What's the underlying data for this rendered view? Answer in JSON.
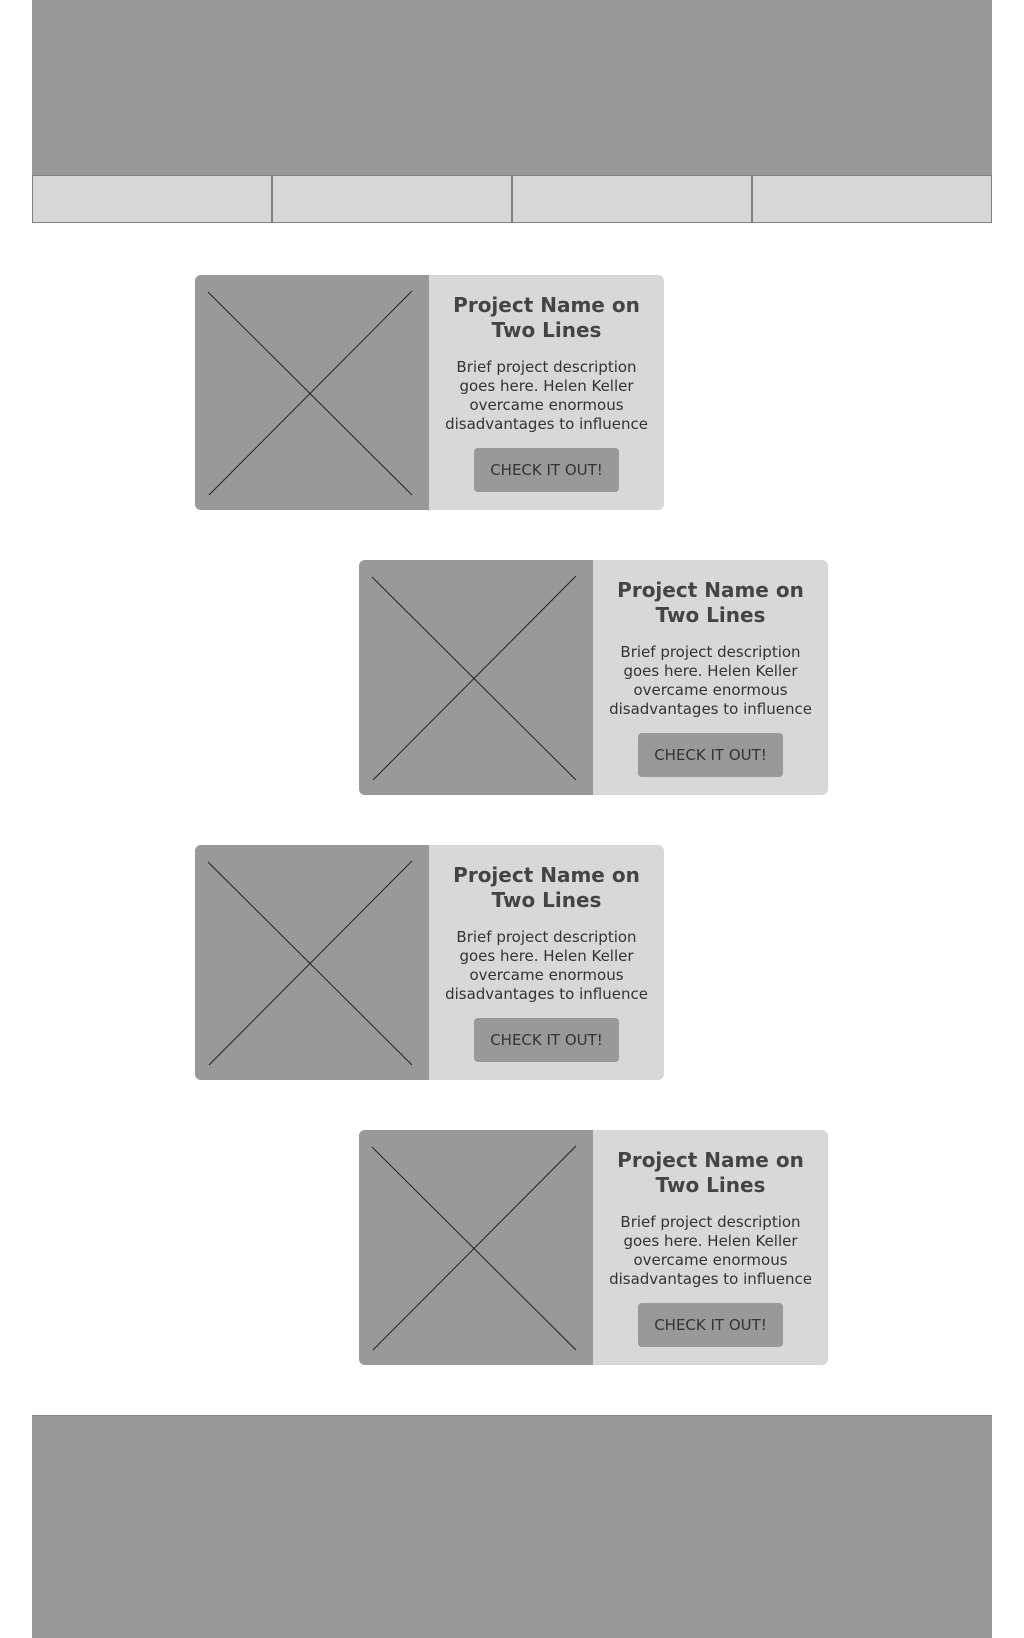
{
  "header": {
    "banner_icon": "header-banner-placeholder"
  },
  "nav": {
    "tabs": [
      {},
      {},
      {},
      {}
    ]
  },
  "projects": [
    {
      "title": "Project Name on Two Lines",
      "description": "Brief project description goes here. Helen Keller overcame enormous disadvantages to influence",
      "button_label": "CHECK IT OUT!",
      "image_icon": "image-placeholder-icon"
    },
    {
      "title": "Project Name on Two Lines",
      "description": "Brief project description goes here. Helen Keller overcame enormous disadvantages to influence",
      "button_label": "CHECK IT OUT!",
      "image_icon": "image-placeholder-icon"
    },
    {
      "title": "Project Name on Two Lines",
      "description": "Brief project description goes here. Helen Keller overcame enormous disadvantages to influence",
      "button_label": "CHECK IT OUT!",
      "image_icon": "image-placeholder-icon"
    },
    {
      "title": "Project Name on Two Lines",
      "description": "Brief project description goes here. Helen Keller overcame enormous disadvantages to influence",
      "button_label": "CHECK IT OUT!",
      "image_icon": "image-placeholder-icon"
    }
  ],
  "colors": {
    "placeholder_dark": "#999999",
    "placeholder_light": "#d8d8d8",
    "title_text": "#444444",
    "body_text": "#333333"
  }
}
